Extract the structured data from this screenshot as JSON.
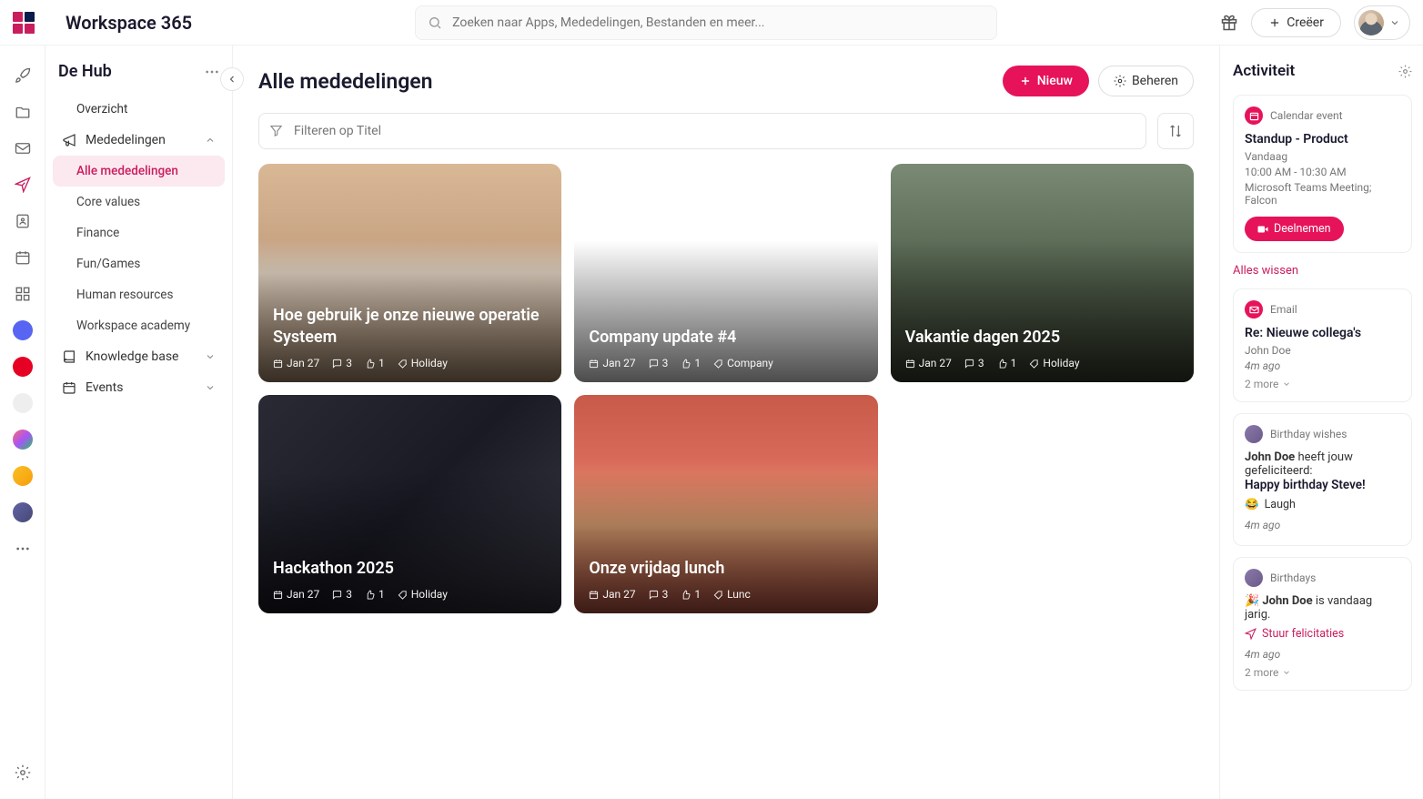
{
  "brand": "Workspace 365",
  "search": {
    "placeholder": "Zoeken naar Apps, Mededelingen, Bestanden en meer..."
  },
  "create_btn": "Creëer",
  "sidebar": {
    "title": "De Hub",
    "items": [
      {
        "label": "Overzicht"
      },
      {
        "label": "Mededelingen"
      },
      {
        "label": "Alle mededelingen"
      },
      {
        "label": "Core values"
      },
      {
        "label": "Finance"
      },
      {
        "label": "Fun/Games"
      },
      {
        "label": "Human resources"
      },
      {
        "label": "Workspace academy"
      },
      {
        "label": "Knowledge base"
      },
      {
        "label": "Events"
      }
    ]
  },
  "page": {
    "title": "Alle mededelingen",
    "new_btn": "Nieuw",
    "manage_btn": "Beheren",
    "filter_placeholder": "Filteren op Titel"
  },
  "cards": [
    {
      "title": "Hoe gebruik je onze nieuwe operatie Systeem",
      "date": "Jan 27",
      "comments": "3",
      "likes": "1",
      "tag": "Holiday"
    },
    {
      "title": "Company update #4",
      "date": "Jan 27",
      "comments": "3",
      "likes": "1",
      "tag": "Company"
    },
    {
      "title": "Vakantie dagen 2025",
      "date": "Jan 27",
      "comments": "3",
      "likes": "1",
      "tag": "Holiday"
    },
    {
      "title": "Hackathon 2025",
      "date": "Jan 27",
      "comments": "3",
      "likes": "1",
      "tag": "Holiday"
    },
    {
      "title": "Onze vrijdag lunch",
      "date": "Jan 27",
      "comments": "3",
      "likes": "1",
      "tag": "Lunc"
    }
  ],
  "activity": {
    "title": "Activiteit",
    "clear": "Alles wissen",
    "items": [
      {
        "type": "Calendar event",
        "title": "Standup - Product",
        "sub1": "Vandaag",
        "sub2": "10:00 AM - 10:30 AM",
        "sub3": "Microsoft Teams Meeting; Falcon",
        "join": "Deelnemen"
      },
      {
        "type": "Email",
        "title": "Re: Nieuwe collega's",
        "sub1": "John Doe",
        "time": "4m ago",
        "more": "2 more"
      },
      {
        "type": "Birthday wishes",
        "bold": "John Doe",
        "rest": " heeft jouw gefeliciteerd:",
        "title2": "Happy birthday Steve!",
        "emoji": "😂",
        "react": "Laugh",
        "time": "4m ago"
      },
      {
        "type": "Birthdays",
        "emoji": "🎉",
        "bold": "John Doe",
        "rest": " is vandaag jarig.",
        "send": "Stuur felicitaties",
        "time": "4m ago",
        "more": "2 more"
      }
    ]
  }
}
